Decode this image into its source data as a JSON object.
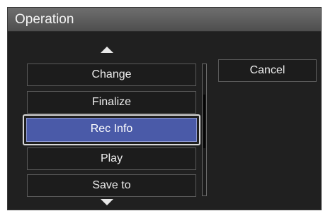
{
  "dialog": {
    "title": "Operation"
  },
  "menu": {
    "items": [
      {
        "label": "Change"
      },
      {
        "label": "Finalize"
      },
      {
        "label": "Rec Info"
      },
      {
        "label": "Play"
      },
      {
        "label": "Save to"
      }
    ],
    "selected_index": 2
  },
  "cancel": {
    "label": "Cancel"
  },
  "colors": {
    "selected_fill": "#4a5aa8",
    "background": "#202020",
    "titlebar": "#5e5e5e"
  },
  "icons": {
    "scroll_up": "triangle-up-icon",
    "scroll_down": "triangle-down-icon"
  }
}
